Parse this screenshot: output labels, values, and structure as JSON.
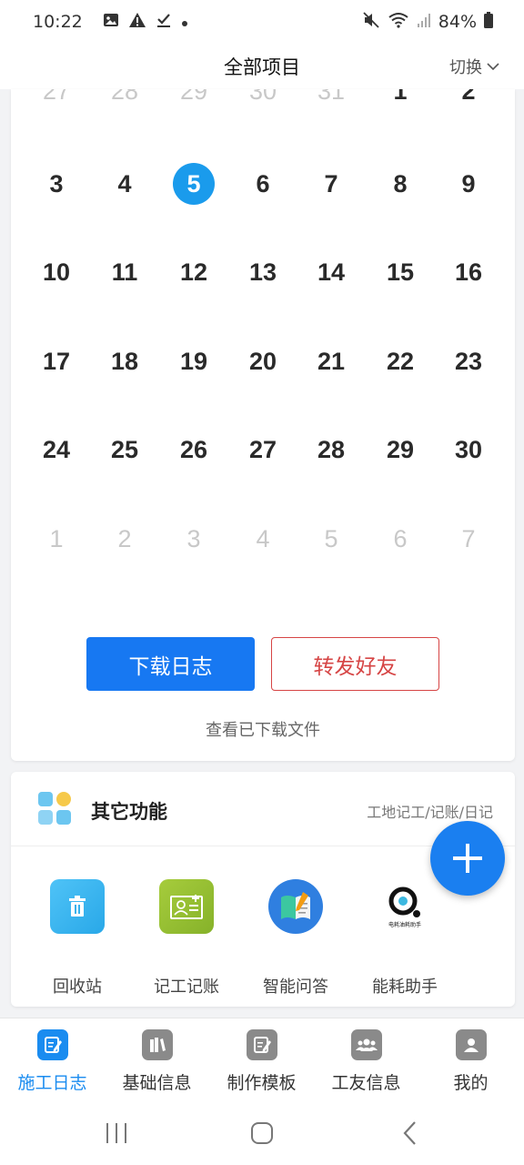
{
  "status_bar": {
    "time": "10:22",
    "battery": "84%"
  },
  "header": {
    "title": "全部项目",
    "switch_label": "切换"
  },
  "calendar": {
    "partial_top_row": [
      "27",
      "28",
      "29",
      "30",
      "31",
      "1",
      "2"
    ],
    "rows": [
      [
        "3",
        "4",
        "5",
        "6",
        "7",
        "8",
        "9"
      ],
      [
        "10",
        "11",
        "12",
        "13",
        "14",
        "15",
        "16"
      ],
      [
        "17",
        "18",
        "19",
        "20",
        "21",
        "22",
        "23"
      ],
      [
        "24",
        "25",
        "26",
        "27",
        "28",
        "29",
        "30"
      ],
      [
        "1",
        "2",
        "3",
        "4",
        "5",
        "6",
        "7"
      ]
    ],
    "selected_day": "5"
  },
  "actions": {
    "download_label": "下载日志",
    "share_label": "转发好友",
    "view_files_label": "查看已下载文件"
  },
  "other_functions": {
    "title": "其它功能",
    "subtitle": "工地记工/记账/日记",
    "items": [
      {
        "label": "回收站",
        "icon": "trash-icon"
      },
      {
        "label": "记工记账",
        "icon": "id-card-icon"
      },
      {
        "label": "智能问答",
        "icon": "notebook-icon"
      },
      {
        "label": "能耗助手",
        "icon": "energy-logo-icon",
        "logo_text": "电耗油耗助手"
      }
    ]
  },
  "tabs": [
    {
      "label": "施工日志",
      "active": true
    },
    {
      "label": "基础信息",
      "active": false
    },
    {
      "label": "制作模板",
      "active": false
    },
    {
      "label": "工友信息",
      "active": false
    },
    {
      "label": "我的",
      "active": false
    }
  ],
  "colors": {
    "primary": "#1778f2",
    "selected_day": "#1a9bec",
    "share_red": "#d64545",
    "tab_active": "#1a8cf0"
  }
}
